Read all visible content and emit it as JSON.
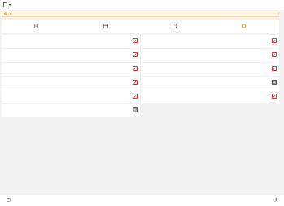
{
  "header": {
    "title": ""
  },
  "notice": {
    "text_before": "",
    "count": "4",
    "text_after": "",
    "link": ""
  },
  "tabs": [
    {
      "label": "",
      "icon": "file-icon"
    },
    {
      "label": "",
      "icon": "calendar-icon"
    },
    {
      "label": "",
      "icon": "document-edit-icon"
    },
    {
      "label": "",
      "icon": "badge-icon"
    }
  ],
  "items": [
    {
      "title": "",
      "subtitle": ""
    },
    {
      "title": "",
      "subtitle": ""
    },
    {
      "title": "",
      "subtitle": ""
    },
    {
      "title": "",
      "subtitle": ""
    },
    {
      "title": "",
      "subtitle": ""
    },
    {
      "title": "",
      "subtitle": ""
    },
    {
      "title": "",
      "subtitle": ""
    },
    {
      "title": "",
      "subtitle": ""
    },
    {
      "title": "",
      "subtitle": ""
    },
    {
      "title": "",
      "subtitle": ""
    },
    {
      "title": "",
      "subtitle": ""
    }
  ],
  "bottom_nav": [
    {
      "label": "",
      "icon": "home-icon"
    },
    {
      "label": "",
      "icon": "user-icon"
    }
  ],
  "colors": {
    "accent": "#c83b3b",
    "notice_text": "#d08a1a",
    "notice_bg": "#fdf3df"
  }
}
